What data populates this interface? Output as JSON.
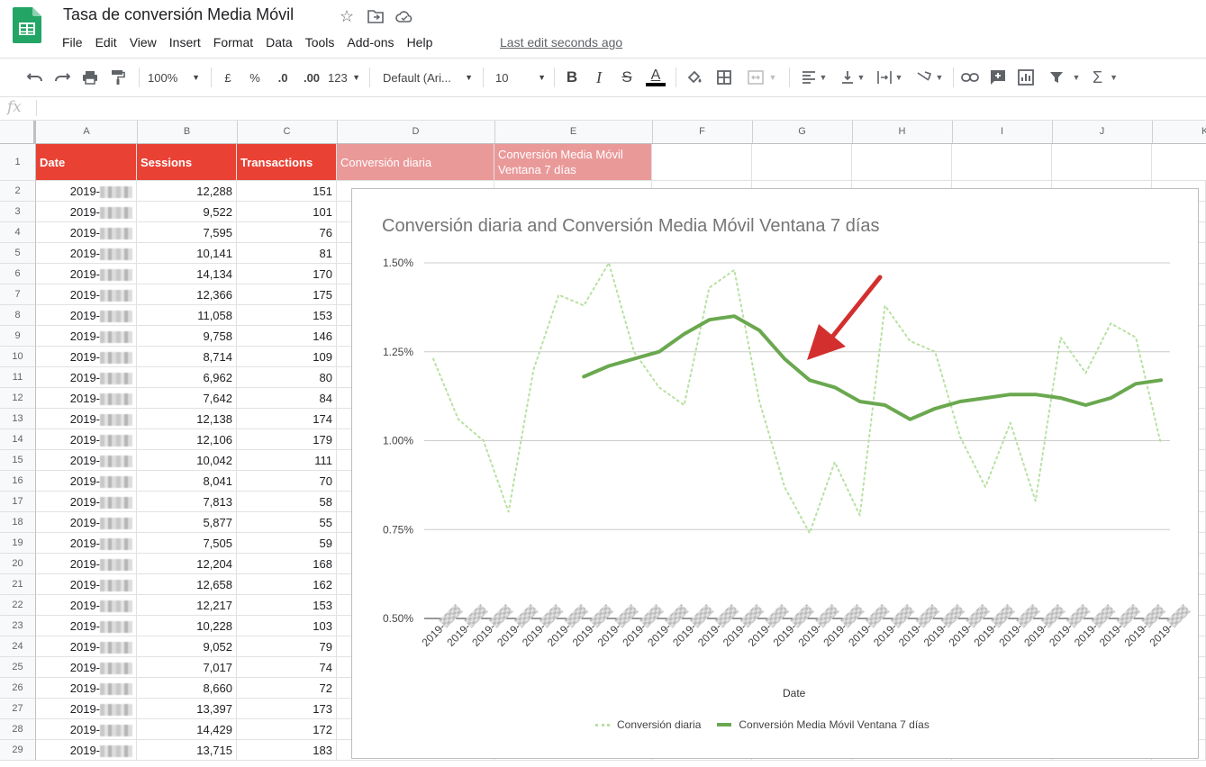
{
  "app": {
    "doc_title": "Tasa de conversión Media Móvil",
    "menu": [
      "File",
      "Edit",
      "View",
      "Insert",
      "Format",
      "Data",
      "Tools",
      "Add-ons",
      "Help"
    ],
    "last_edit": "Last edit seconds ago"
  },
  "toolbar": {
    "zoom": "100%",
    "currency": "£",
    "percent": "%",
    "dec_less": ".0",
    "dec_more": ".00",
    "format_more": "123",
    "font": "Default (Ari...",
    "font_size": "10",
    "bold": "B",
    "italic": "I",
    "strike": "S",
    "text_color": "A",
    "sum": "Σ"
  },
  "formula_bar": {
    "label": "fx",
    "value": ""
  },
  "columns": [
    "A",
    "B",
    "C",
    "D",
    "E",
    "F",
    "G",
    "H",
    "I",
    "J",
    "K"
  ],
  "header_row": {
    "row": "1",
    "a": "Date",
    "b": "Sessions",
    "c": "Transactions",
    "d": "Conversión diaria",
    "e": "Conversión Media Móvil Ventana 7 días"
  },
  "date_prefix": "2019-",
  "rows": [
    {
      "n": "2",
      "sessions": "12,288",
      "transactions": "151"
    },
    {
      "n": "3",
      "sessions": "9,522",
      "transactions": "101"
    },
    {
      "n": "4",
      "sessions": "7,595",
      "transactions": "76"
    },
    {
      "n": "5",
      "sessions": "10,141",
      "transactions": "81"
    },
    {
      "n": "6",
      "sessions": "14,134",
      "transactions": "170"
    },
    {
      "n": "7",
      "sessions": "12,366",
      "transactions": "175"
    },
    {
      "n": "8",
      "sessions": "11,058",
      "transactions": "153"
    },
    {
      "n": "9",
      "sessions": "9,758",
      "transactions": "146"
    },
    {
      "n": "10",
      "sessions": "8,714",
      "transactions": "109"
    },
    {
      "n": "11",
      "sessions": "6,962",
      "transactions": "80"
    },
    {
      "n": "12",
      "sessions": "7,642",
      "transactions": "84"
    },
    {
      "n": "13",
      "sessions": "12,138",
      "transactions": "174"
    },
    {
      "n": "14",
      "sessions": "12,106",
      "transactions": "179"
    },
    {
      "n": "15",
      "sessions": "10,042",
      "transactions": "111"
    },
    {
      "n": "16",
      "sessions": "8,041",
      "transactions": "70"
    },
    {
      "n": "17",
      "sessions": "7,813",
      "transactions": "58"
    },
    {
      "n": "18",
      "sessions": "5,877",
      "transactions": "55"
    },
    {
      "n": "19",
      "sessions": "7,505",
      "transactions": "59"
    },
    {
      "n": "20",
      "sessions": "12,204",
      "transactions": "168"
    },
    {
      "n": "21",
      "sessions": "12,658",
      "transactions": "162"
    },
    {
      "n": "22",
      "sessions": "12,217",
      "transactions": "153"
    },
    {
      "n": "23",
      "sessions": "10,228",
      "transactions": "103"
    },
    {
      "n": "24",
      "sessions": "9,052",
      "transactions": "79"
    },
    {
      "n": "25",
      "sessions": "7,017",
      "transactions": "74"
    },
    {
      "n": "26",
      "sessions": "8,660",
      "transactions": "72"
    },
    {
      "n": "27",
      "sessions": "13,397",
      "transactions": "173"
    },
    {
      "n": "28",
      "sessions": "14,429",
      "transactions": "172"
    },
    {
      "n": "29",
      "sessions": "13,715",
      "transactions": "183"
    }
  ],
  "colors": {
    "header_red": "#e94235",
    "header_pink": "#ea9999",
    "series_daily": "#b7e1a1",
    "series_ma": "#6aa84f",
    "arrow": "#d32f2f"
  },
  "chart_data": {
    "type": "line",
    "title": "Conversión diaria and Conversión Media Móvil Ventana 7 días",
    "xlabel": "Date",
    "ylabel": "",
    "ylim": [
      0.005,
      0.015
    ],
    "y_ticks": [
      "0.50%",
      "0.75%",
      "1.00%",
      "1.25%",
      "1.50%"
    ],
    "x_tick_label": "2019-",
    "legend": "bottom",
    "series": [
      {
        "name": "Conversión diaria",
        "style": "dotted",
        "values": [
          0.0123,
          0.0106,
          0.01,
          0.008,
          0.012,
          0.0141,
          0.0138,
          0.015,
          0.0125,
          0.0115,
          0.011,
          0.0143,
          0.0148,
          0.0111,
          0.0087,
          0.0074,
          0.0094,
          0.0079,
          0.0138,
          0.0128,
          0.0125,
          0.0101,
          0.0087,
          0.0105,
          0.0083,
          0.0129,
          0.0119,
          0.0133,
          0.0129,
          0.0099
        ]
      },
      {
        "name": "Conversión Media Móvil Ventana 7 días",
        "style": "solid",
        "values": [
          null,
          null,
          null,
          null,
          null,
          null,
          0.0118,
          0.0121,
          0.0123,
          0.0125,
          0.013,
          0.0134,
          0.0135,
          0.0131,
          0.0123,
          0.0117,
          0.0115,
          0.0111,
          0.011,
          0.0106,
          0.0109,
          0.0111,
          0.0112,
          0.0113,
          0.0113,
          0.0112,
          0.011,
          0.0112,
          0.0116,
          0.0117
        ]
      }
    ]
  }
}
